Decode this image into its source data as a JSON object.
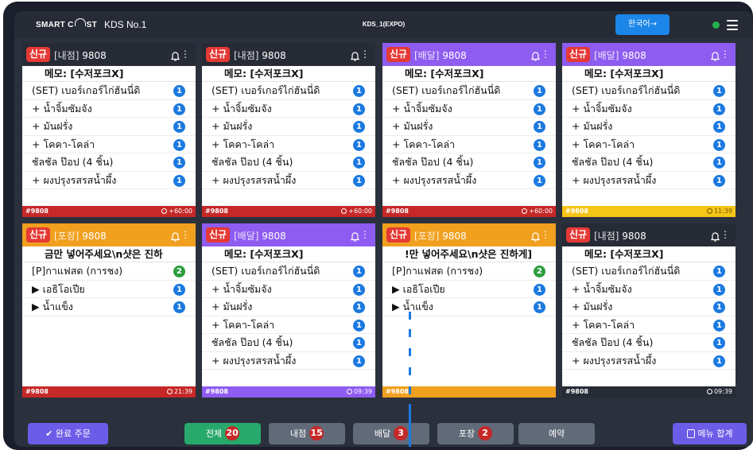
{
  "header": {
    "logo": "SMART CAST",
    "kds_name": "KDS No.1",
    "kds_id": "KDS_1(EXPO)",
    "lang_button": "한국어→"
  },
  "colors": {
    "dark": "#262b35",
    "purple": "#8e5cf0",
    "orange": "#f0a01e",
    "red": "#c62828",
    "yellow": "#f5c518",
    "blue": "#1b79e0",
    "green": "#22b14c"
  },
  "orders": [
    {
      "status": "신규",
      "type": "[내점]",
      "num": "9808",
      "header_color": "dark",
      "memo": "메모: [수저포크X]",
      "items": [
        {
          "name": "(SET) เบอร์เกอร์ไก่ฮันนี่ดิ",
          "qty": "1",
          "color": "blue"
        },
        {
          "name": "+ น้ำจิ้มซัมจัง",
          "qty": "1",
          "color": "blue"
        },
        {
          "name": "+ มันฝรั่ง",
          "qty": "1",
          "color": "blue"
        },
        {
          "name": "+ โคคา-โคล่า",
          "qty": "1",
          "color": "blue"
        },
        {
          "name": "ชัลชัล ป๊อป (4 ชิ้น)",
          "qty": "1",
          "color": "blue"
        },
        {
          "name": "+ ผงปรุงรสรสน้ำผึ้ง",
          "qty": "1",
          "color": "blue"
        }
      ],
      "footer_num": "#9808",
      "footer_time": "+60:00",
      "footer_color": "red"
    },
    {
      "status": "신규",
      "type": "[내점]",
      "num": "9808",
      "header_color": "dark",
      "memo": "메모: [수저포크X]",
      "items": [
        {
          "name": "(SET) เบอร์เกอร์ไก่ฮันนี่ดิ",
          "qty": "1",
          "color": "blue"
        },
        {
          "name": "+ น้ำจิ้มซัมจัง",
          "qty": "1",
          "color": "blue"
        },
        {
          "name": "+ มันฝรั่ง",
          "qty": "1",
          "color": "blue"
        },
        {
          "name": "+ โคคา-โคล่า",
          "qty": "1",
          "color": "blue"
        },
        {
          "name": "ชัลชัล ป๊อป (4 ชิ้น)",
          "qty": "1",
          "color": "blue"
        },
        {
          "name": "+ ผงปรุงรสรสน้ำผึ้ง",
          "qty": "1",
          "color": "blue"
        }
      ],
      "footer_num": "#9808",
      "footer_time": "+60:00",
      "footer_color": "red"
    },
    {
      "status": "신규",
      "type": "[배달]",
      "num": "9808",
      "header_color": "purple",
      "memo": "메모: [수저포크X]",
      "items": [
        {
          "name": "(SET) เบอร์เกอร์ไก่ฮันนี่ดิ",
          "qty": "1",
          "color": "blue"
        },
        {
          "name": "+ น้ำจิ้มซัมจัง",
          "qty": "1",
          "color": "blue"
        },
        {
          "name": "+ มันฝรั่ง",
          "qty": "1",
          "color": "blue"
        },
        {
          "name": "+ โคคา-โคล่า",
          "qty": "1",
          "color": "blue"
        },
        {
          "name": "ชัลชัล ป๊อป (4 ชิ้น)",
          "qty": "1",
          "color": "blue"
        },
        {
          "name": "+ ผงปรุงรสรสน้ำผึ้ง",
          "qty": "1",
          "color": "blue"
        }
      ],
      "footer_num": "#9808",
      "footer_time": "+60:00",
      "footer_color": "red"
    },
    {
      "status": "신규",
      "type": "[배달]",
      "num": "9808",
      "header_color": "purple",
      "memo": "메모: [수저포크X]",
      "items": [
        {
          "name": "(SET) เบอร์เกอร์ไก่ฮันนี่ดิ",
          "qty": "1",
          "color": "blue"
        },
        {
          "name": "+ น้ำจิ้มซัมจัง",
          "qty": "1",
          "color": "blue"
        },
        {
          "name": "+ มันฝรั่ง",
          "qty": "1",
          "color": "blue"
        },
        {
          "name": "+ โคคา-โคล่า",
          "qty": "1",
          "color": "blue"
        },
        {
          "name": "ชัลชัล ป๊อป (4 ชิ้น)",
          "qty": "1",
          "color": "blue"
        },
        {
          "name": "+ ผงปรุงรสรสน้ำผึ้ง",
          "qty": "1",
          "color": "blue"
        }
      ],
      "footer_num": "#9808",
      "footer_time": "11:39",
      "footer_color": "yellow"
    },
    {
      "status": "신규",
      "type": "[포장]",
      "num": "9808",
      "header_color": "orange",
      "memo": "금만 넣어주세요\\n샷은 진하",
      "items": [
        {
          "name": "[P]กาแฟสด (การชง)",
          "qty": "2",
          "color": "green"
        },
        {
          "name": "▶ เอธิโอเปีย",
          "qty": "1",
          "color": "blue"
        },
        {
          "name": "▶ น้ำแข็ง",
          "qty": "1",
          "color": "blue"
        }
      ],
      "footer_num": "#9808",
      "footer_time": "21:39",
      "footer_color": "red"
    },
    {
      "status": "신규",
      "type": "[배달]",
      "num": "9808",
      "header_color": "purple",
      "memo": "메모: [수저포크X]",
      "items": [
        {
          "name": "(SET) เบอร์เกอร์ไก่ฮันนี่ดิ",
          "qty": "1",
          "color": "blue"
        },
        {
          "name": "+ น้ำจิ้มซัมจัง",
          "qty": "1",
          "color": "blue"
        },
        {
          "name": "+ มันฝรั่ง",
          "qty": "1",
          "color": "blue"
        },
        {
          "name": "+ โคคา-โคล่า",
          "qty": "1",
          "color": "blue"
        },
        {
          "name": "ชัลชัล ป๊อป (4 ชิ้น)",
          "qty": "1",
          "color": "blue"
        },
        {
          "name": "+ ผงปรุงรสรสน้ำผึ้ง",
          "qty": "1",
          "color": "blue"
        }
      ],
      "footer_num": "#9808",
      "footer_time": "09:39",
      "footer_color": "purple"
    },
    {
      "status": "신규",
      "type": "[포장]",
      "num": "9808",
      "header_color": "orange",
      "memo": "!만 넣어주세요\\n샷은 진하게]",
      "items": [
        {
          "name": "[P]กาแฟสด (การชง)",
          "qty": "2",
          "color": "green"
        },
        {
          "name": "▶ เอธิโอเปีย",
          "qty": "1",
          "color": "blue"
        },
        {
          "name": "▶ น้ำแข็ง",
          "qty": "1",
          "color": "blue"
        }
      ],
      "footer_num": "#9808",
      "footer_time": "",
      "footer_color": "orange"
    },
    {
      "status": "신규",
      "type": "[내점]",
      "num": "9808",
      "header_color": "dark",
      "memo": "메모: [수저포크X]",
      "items": [
        {
          "name": "(SET) เบอร์เกอร์ไก่ฮันนี่ดิ",
          "qty": "1",
          "color": "blue"
        },
        {
          "name": "+ น้ำจิ้มซัมจัง",
          "qty": "1",
          "color": "blue"
        },
        {
          "name": "+ มันฝรั่ง",
          "qty": "1",
          "color": "blue"
        },
        {
          "name": "+ โคคา-โคล่า",
          "qty": "1",
          "color": "blue"
        },
        {
          "name": "ชัลชัล ป๊อป (4 ชิ้น)",
          "qty": "1",
          "color": "blue"
        },
        {
          "name": "+ ผงปรุงรสรสน้ำผึ้ง",
          "qty": "1",
          "color": "blue"
        }
      ],
      "footer_num": "#9808",
      "footer_time": "09:39",
      "footer_color": "dark"
    }
  ],
  "bottom": {
    "completed": "✔ 완료 주문",
    "tabs": [
      {
        "label": "전체",
        "count": "20",
        "color": "#27a96b"
      },
      {
        "label": "내점",
        "count": "15",
        "color": "#616a78"
      },
      {
        "label": "배달",
        "count": "3",
        "color": "#616a78"
      },
      {
        "label": "포장",
        "count": "2",
        "color": "#616a78"
      },
      {
        "label": "예약",
        "count": "",
        "color": "#616a78"
      }
    ],
    "menu_sum": "메뉴 합계"
  }
}
